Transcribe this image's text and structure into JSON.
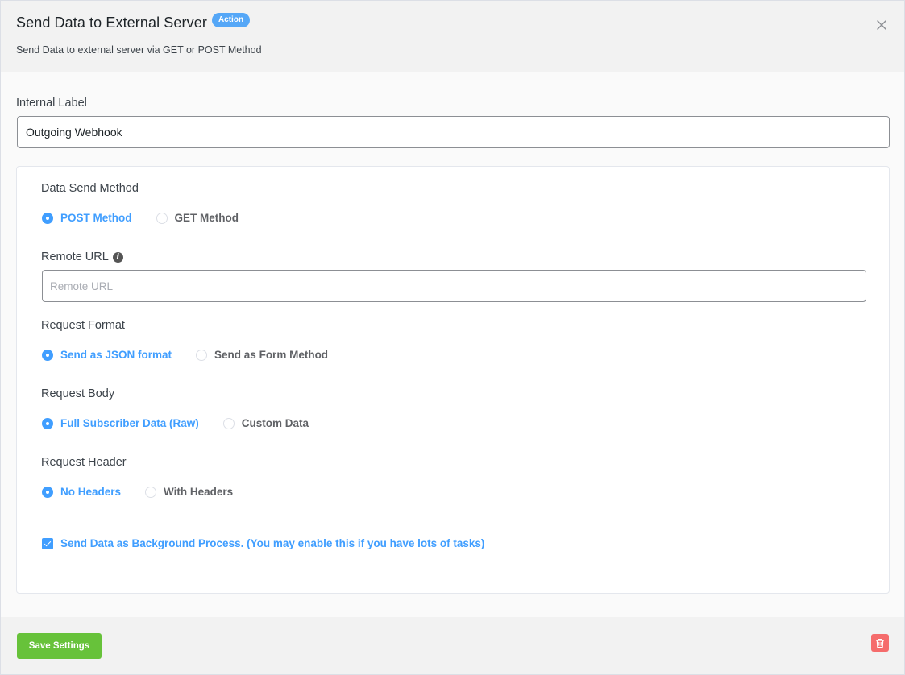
{
  "header": {
    "title": "Send Data to External Server",
    "badge": "Action",
    "subtitle": "Send Data to external server via GET or POST Method"
  },
  "internal_label": {
    "label": "Internal Label",
    "value": "Outgoing Webhook"
  },
  "data_send_method": {
    "label": "Data Send Method",
    "options": [
      "POST Method",
      "GET Method"
    ],
    "selected": "POST Method"
  },
  "remote_url": {
    "label": "Remote URL",
    "placeholder": "Remote URL",
    "value": ""
  },
  "request_format": {
    "label": "Request Format",
    "options": [
      "Send as JSON format",
      "Send as Form Method"
    ],
    "selected": "Send as JSON format"
  },
  "request_body": {
    "label": "Request Body",
    "options": [
      "Full Subscriber Data (Raw)",
      "Custom Data"
    ],
    "selected": "Full Subscriber Data (Raw)"
  },
  "request_header": {
    "label": "Request Header",
    "options": [
      "No Headers",
      "With Headers"
    ],
    "selected": "No Headers"
  },
  "background_process": {
    "label": "Send Data as Background Process. (You may enable this if you have lots of tasks)",
    "checked": true
  },
  "footer": {
    "save_label": "Save Settings"
  },
  "colors": {
    "accent": "#409eff",
    "save": "#67c23a",
    "delete": "#f56c6c",
    "badge": "#55a7f7"
  },
  "icons": {
    "close": "close-icon",
    "info": "info-icon",
    "delete": "trash-icon"
  }
}
